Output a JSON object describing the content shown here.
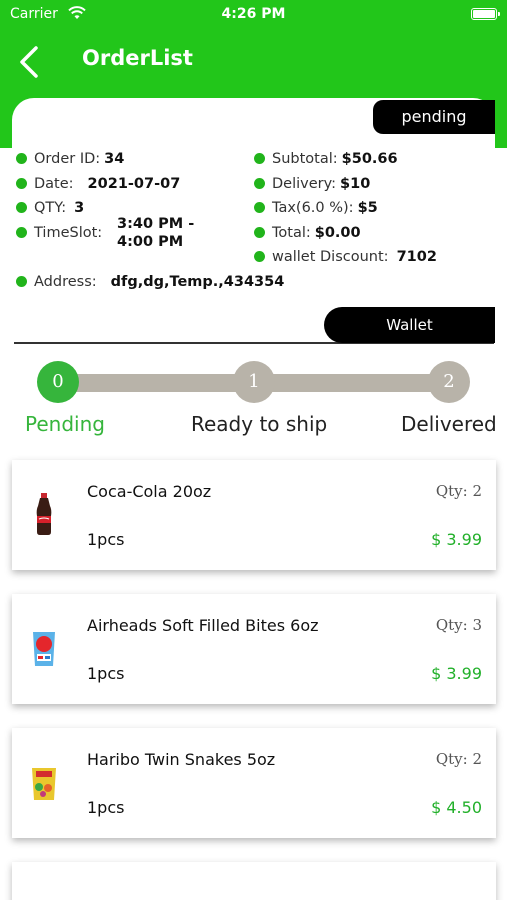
{
  "status_bar": {
    "carrier": "Carrier",
    "time": "4:26 PM"
  },
  "nav": {
    "title": "OrderList",
    "back_icon": "chevron-left-icon"
  },
  "order": {
    "status": "pending",
    "left": [
      {
        "label": "Order ID:",
        "value": "34"
      },
      {
        "label": "Date:",
        "value": "2021-07-07"
      },
      {
        "label": "QTY:",
        "value": "3"
      },
      {
        "label": "TimeSlot:",
        "value": "3:40 PM - 4:00 PM"
      }
    ],
    "right": [
      {
        "label": "Subtotal:",
        "value": "$50.66"
      },
      {
        "label": "Delivery:",
        "value": "$10"
      },
      {
        "label": "Tax(6.0 %):",
        "value": "$5"
      },
      {
        "label": "Total:",
        "value": "$0.00"
      },
      {
        "label": "wallet Discount:",
        "value": "7102"
      }
    ],
    "address": {
      "label": "Address:",
      "value": "dfg,dg,Temp.,434354"
    },
    "payment_method": "Wallet"
  },
  "progress": {
    "current_step": 0,
    "steps": [
      {
        "number": "0",
        "label": "Pending"
      },
      {
        "number": "1",
        "label": "Ready to ship"
      },
      {
        "number": "2",
        "label": "Delivered"
      }
    ]
  },
  "products": [
    {
      "name": "Coca-Cola 20oz",
      "qty_label": "Qty:",
      "qty": "2",
      "unit": "1pcs",
      "price": "$ 3.99"
    },
    {
      "name": "Airheads Soft Filled Bites 6oz",
      "qty_label": "Qty:",
      "qty": "3",
      "unit": "1pcs",
      "price": "$ 3.99"
    },
    {
      "name": "Haribo Twin Snakes 5oz",
      "qty_label": "Qty:",
      "qty": "2",
      "unit": "1pcs",
      "price": "$ 4.50"
    }
  ],
  "colors": {
    "brand_green": "#22c61a",
    "dot_green": "#21b41b",
    "price_green": "#22b02a",
    "track_gray": "#b8b3a9"
  }
}
